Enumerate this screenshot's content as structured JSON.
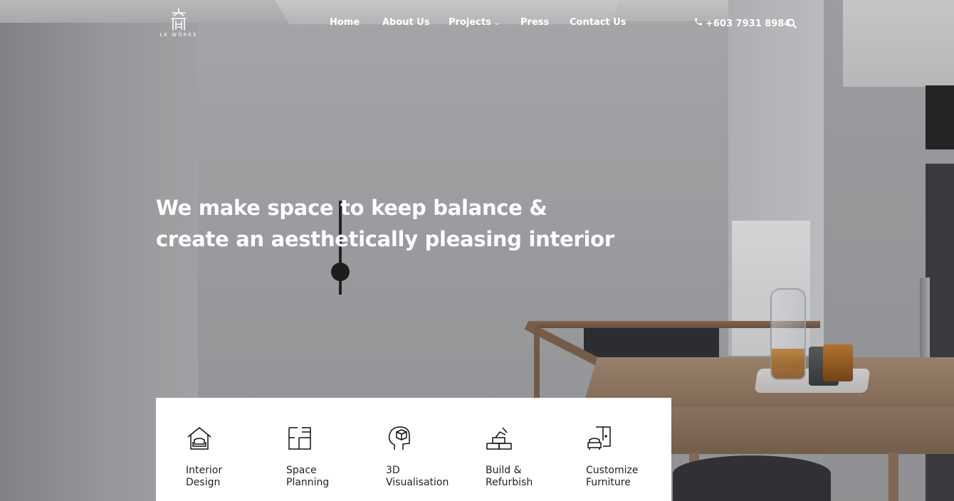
{
  "brand": {
    "logo_text": "LK WÖRKS"
  },
  "nav": {
    "items": [
      {
        "label": "Home"
      },
      {
        "label": "About Us"
      },
      {
        "label": "Projects",
        "has_dropdown": true
      },
      {
        "label": "Press"
      },
      {
        "label": "Contact Us"
      }
    ],
    "phone": "+603 7931 8984"
  },
  "hero": {
    "line1": "We make space to keep balance &",
    "line2": "create an aesthetically pleasing interior"
  },
  "services": [
    {
      "line1": "Interior",
      "line2": "Design",
      "icon": "house-sofa-icon"
    },
    {
      "line1": "Space",
      "line2": "Planning",
      "icon": "floorplan-icon"
    },
    {
      "line1": "3D",
      "line2": "Visualisation",
      "icon": "head-cube-icon"
    },
    {
      "line1": "Build &",
      "line2": "Refurbish",
      "icon": "bricks-trowel-icon"
    },
    {
      "line1": "Customize",
      "line2": "Furniture",
      "icon": "armchair-door-icon"
    }
  ],
  "colors": {
    "text_light": "#ffffff",
    "card_bg": "#ffffff",
    "card_text": "#222222"
  }
}
